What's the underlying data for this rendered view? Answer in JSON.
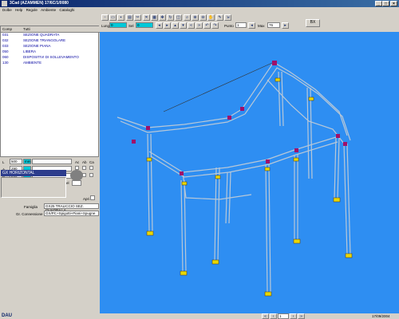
{
  "window": {
    "title": "3Cad (AZAMMEN) 17/6C/1/0080"
  },
  "menu": [
    "Dolbe",
    "Help",
    "Regole",
    "Ambiente",
    "Cataloghi"
  ],
  "toolbar": {
    "lung_label": "Lung",
    "lung_value": "0",
    "sel_label": "Sel",
    "sel_value": "0",
    "punto_label": "Punto",
    "punto_value": "1",
    "max_label": "Max",
    "max_value": "76",
    "bx_label": "BX"
  },
  "list": {
    "headers": [
      "Comp",
      "Tutti"
    ],
    "rows": [
      {
        "code": "031",
        "name": "SEZIONE QUADRATA"
      },
      {
        "code": "032",
        "name": "SEZIONE TRIANGOLARE"
      },
      {
        "code": "033",
        "name": "SEZIONE PIANA"
      },
      {
        "code": "050",
        "name": "LIBERA"
      },
      {
        "code": "060",
        "name": "DISPOSITIVI DI SOLLEVAMENTO"
      },
      {
        "code": "130",
        "name": "AMBIENTE"
      }
    ]
  },
  "props": {
    "l_label": "L",
    "l_value": "500",
    "l_unit": "mm",
    "a_label": "A",
    "a_value": "290",
    "p_label": "P",
    "p_value": "290",
    "col_headers": [
      "Ac",
      "Ab",
      "Ca"
    ],
    "rot_label": "Rot",
    "rot_value": "0",
    "sel2_label": "Sel"
  },
  "selected_item": "GX HORIZONTAL",
  "apri_label": "Apri",
  "famiglia": {
    "label": "Famiglia",
    "value": "GX25 TRALICCIO SEZ. QUADRA LA"
  },
  "connessione": {
    "label": "Gr. Connessione",
    "value": "GX/PC+Spigotti+Piani+Spugne"
  },
  "status": {
    "page": "1",
    "date": "17/09/2004",
    "logo": "DAU"
  },
  "colors": {
    "viewport": "#2e8ef2",
    "selection": "#2c3c8c",
    "field_cyan": "#00c8d8"
  }
}
